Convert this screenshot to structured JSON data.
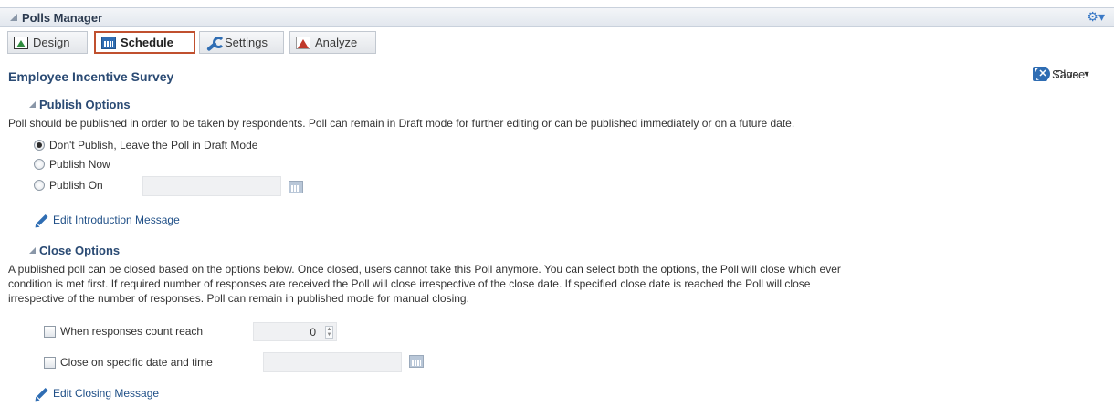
{
  "header": {
    "title": "Polls Manager",
    "gear_icon": "gear-icon"
  },
  "tabs": [
    {
      "label": "Design",
      "icon": "design-icon",
      "active": false
    },
    {
      "label": "Schedule",
      "icon": "calendar-icon",
      "active": true
    },
    {
      "label": "Settings",
      "icon": "wrench-icon",
      "active": false
    },
    {
      "label": "Analyze",
      "icon": "chart-icon",
      "active": false
    }
  ],
  "page": {
    "title": "Employee Incentive Survey"
  },
  "toolbar": {
    "save_label": "Save",
    "close_label": "Close"
  },
  "publish": {
    "heading": "Publish Options",
    "description": "Poll should be published in order to be taken by respondents. Poll can remain in Draft mode for further editing or can be published immediately or on a future date.",
    "options": [
      {
        "label": "Don't Publish, Leave the Poll in Draft Mode",
        "checked": true
      },
      {
        "label": "Publish Now",
        "checked": false
      },
      {
        "label": "Publish On",
        "checked": false
      }
    ],
    "publish_on_value": ""
  },
  "intro_link": "Edit Introduction Message",
  "close": {
    "heading": "Close Options",
    "description_lines": [
      "A published poll can be closed based on the options below. Once closed, users cannot take this Poll anymore. You can select both the options, the Poll will close which ever",
      "condition is met first. If required number of responses are received the Poll will close irrespective of the close date. If specified close date is reached the Poll will close",
      "irrespective of the number of responses. Poll can remain in published mode for manual closing."
    ],
    "responses_label": "When responses count reach",
    "responses_value": "0",
    "date_label": "Close on specific date and time",
    "date_value": ""
  },
  "closing_link": "Edit Closing Message"
}
